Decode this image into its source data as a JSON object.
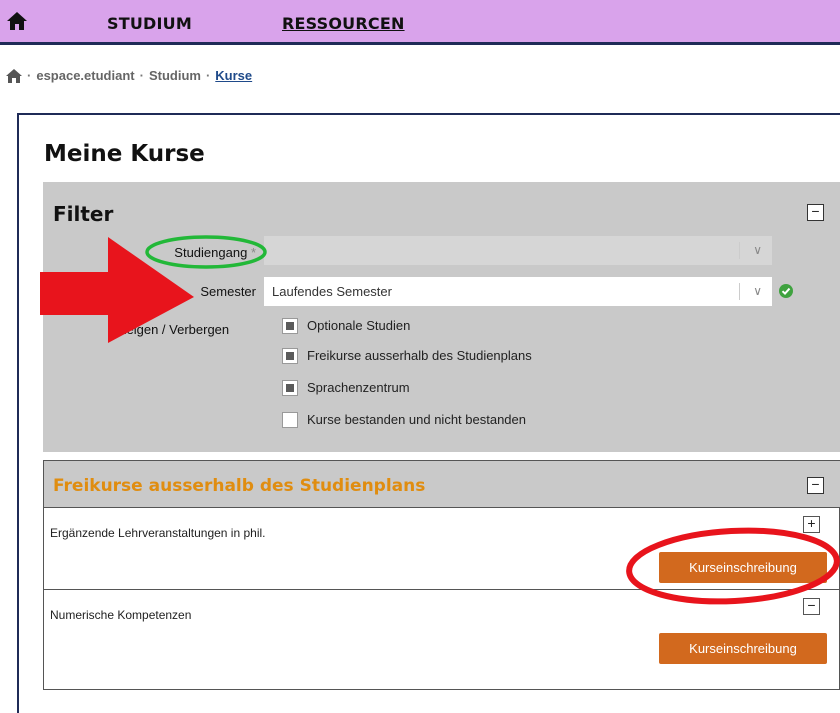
{
  "nav": {
    "home_icon": "home-icon",
    "items": [
      {
        "label": "STUDIUM"
      },
      {
        "label": "RESSOURCEN"
      }
    ]
  },
  "breadcrumb": {
    "home_icon": "home-icon",
    "sep": "·",
    "items": [
      "espace.etudiant",
      "Studium",
      "Kurse"
    ]
  },
  "page": {
    "title": "Meine Kurse"
  },
  "filter": {
    "title": "Filter",
    "collapse": "−",
    "studiengang_label": "Studiengang",
    "required_mark": "*",
    "studiengang_value": "",
    "semester_label": "Semester",
    "semester_value": "Laufendes Semester",
    "toggle_label": "zeigen / Verbergen",
    "checkboxes": [
      {
        "label": "Optionale Studien",
        "checked": true
      },
      {
        "label": "Freikurse ausserhalb des Studienplans",
        "checked": true
      },
      {
        "label": "Sprachenzentrum",
        "checked": true
      },
      {
        "label": "Kurse bestanden und nicht bestanden",
        "checked": false
      }
    ]
  },
  "section": {
    "title": "Freikurse ausserhalb des Studienplans",
    "collapse": "−",
    "rows": [
      {
        "name": "Ergänzende Lehrveranstaltungen in phil.",
        "toggle": "+",
        "button": "Kurseinschreibung"
      },
      {
        "name": "Numerische Kompetenzen",
        "toggle": "−",
        "button": "Kurseinschreibung"
      }
    ]
  },
  "colors": {
    "nav_bg": "#d9a3eb",
    "accent_orange": "#d2691e",
    "section_title": "#e08d10",
    "annotation_red": "#e8141c",
    "annotation_green": "#22b838"
  }
}
